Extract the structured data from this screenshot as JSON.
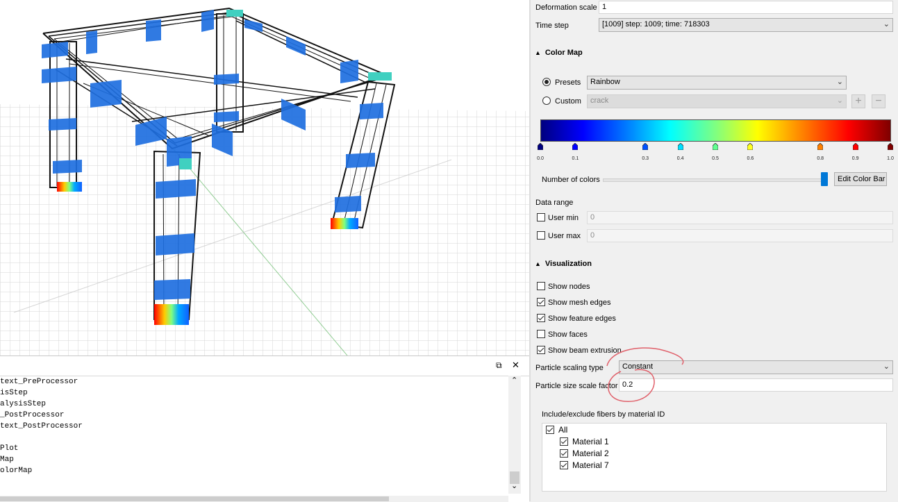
{
  "console": {
    "lines": [
      "text_PreProcessor",
      "isStep",
      "alysisStep",
      "_PostProcessor",
      "text_PostProcessor",
      "",
      "Plot",
      "Map",
      "olorMap"
    ],
    "restore_glyph": "⧉",
    "close_glyph": "✕",
    "scroll_up": "⌃",
    "scroll_down": "⌄"
  },
  "panel": {
    "deformation_scale": {
      "label": "Deformation scale",
      "value": "1"
    },
    "time_step": {
      "label": "Time step",
      "value": "[1009] step: 1009; time: 718303"
    },
    "color_map": {
      "header": "Color Map",
      "presets_label": "Presets",
      "presets_value": "Rainbow",
      "custom_label": "Custom",
      "custom_value": "crack",
      "add_glyph": "+",
      "remove_glyph": "−",
      "ticks": [
        "0.0",
        "0.1",
        "0.3",
        "0.4",
        "0.5",
        "0.6",
        "0.8",
        "0.9",
        "1.0"
      ],
      "marker_colors": [
        "#00007f",
        "#0000ff",
        "#0050ff",
        "#00e0ff",
        "#60ff90",
        "#ffff20",
        "#ff8000",
        "#ff0000",
        "#7f0000"
      ],
      "number_of_colors_label": "Number of colors",
      "number_of_colors_fraction": 0.99,
      "edit_button": "Edit Color Bar"
    },
    "data_range": {
      "header": "Data range",
      "user_min_label": "User min",
      "user_min_value": "0",
      "user_max_label": "User max",
      "user_max_value": "0"
    },
    "visualization": {
      "header": "Visualization",
      "options": [
        {
          "label": "Show nodes",
          "checked": false
        },
        {
          "label": "Show mesh edges",
          "checked": true
        },
        {
          "label": "Show feature edges",
          "checked": true
        },
        {
          "label": "Show faces",
          "checked": false
        },
        {
          "label": "Show beam extrusion",
          "checked": true
        }
      ],
      "particle_scaling_label": "Particle scaling type",
      "particle_scaling_value": "Constant",
      "particle_size_label": "Particle size scale factor",
      "particle_size_value": "0.2"
    },
    "fibers": {
      "header": "Include/exclude fibers by material ID",
      "items": [
        {
          "label": "All",
          "checked": true
        },
        {
          "label": "Material 1",
          "checked": true
        },
        {
          "label": "Material 2",
          "checked": true
        },
        {
          "label": "Material 7",
          "checked": true
        }
      ]
    },
    "arrow_glyph": "⌄",
    "collapse_glyph": "▲"
  }
}
